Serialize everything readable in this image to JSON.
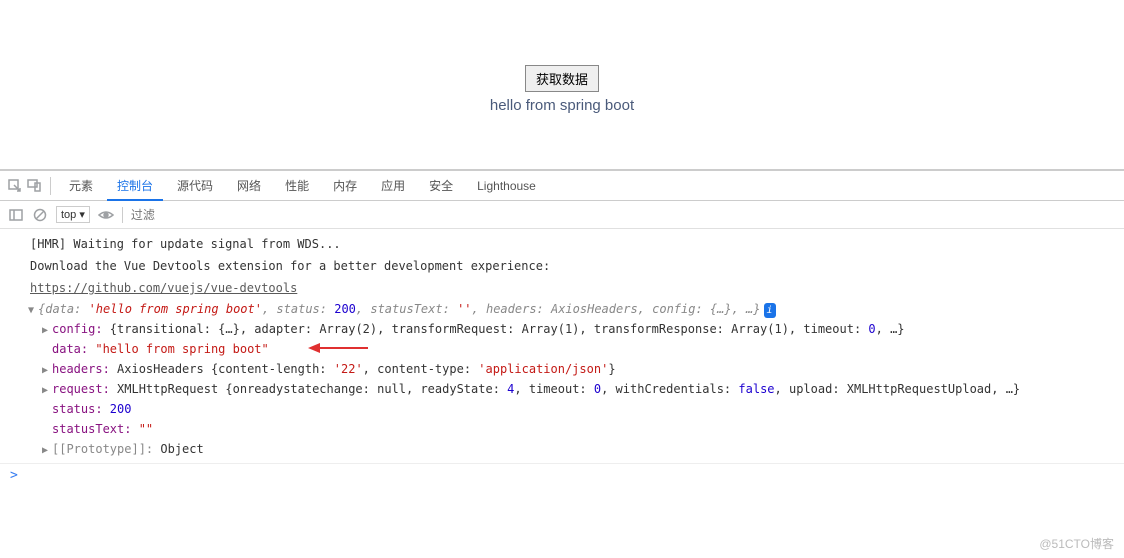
{
  "page": {
    "button_label": "获取数据",
    "response_text": "hello from spring boot"
  },
  "tabs": {
    "elements": "元素",
    "console": "控制台",
    "sources": "源代码",
    "network": "网络",
    "performance": "性能",
    "memory": "内存",
    "application": "应用",
    "security": "安全",
    "lighthouse": "Lighthouse"
  },
  "toolbar": {
    "context": "top ▾",
    "filter_placeholder": "过滤"
  },
  "console": {
    "hmr": "[HMR] Waiting for update signal from WDS...",
    "devtools_msg": "Download the Vue Devtools extension for a better development experience:",
    "devtools_link": "https://github.com/vuejs/vue-devtools",
    "summary_prefix": "{data: ",
    "summary_data": "'hello from spring boot'",
    "summary_mid1": ", status: ",
    "summary_status": "200",
    "summary_mid2": ", statusText: ",
    "summary_statustext": "''",
    "summary_mid3": ", headers: AxiosHeaders, config: {…}, …}",
    "config_key": "config:",
    "config_val": " {transitional: {…}, adapter: Array(2), transformRequest: Array(1), transformResponse: Array(1), timeout: ",
    "config_timeout": "0",
    "config_tail": ", …}",
    "data_key": "data:",
    "data_val": " \"hello from spring boot\"",
    "headers_key": "headers:",
    "headers_pre": " AxiosHeaders {content-length: ",
    "headers_len": "'22'",
    "headers_mid": ", content-type: ",
    "headers_ct": "'application/json'",
    "headers_tail": "}",
    "request_key": "request:",
    "request_pre": " XMLHttpRequest {onreadystatechange: null, readyState: ",
    "request_rs": "4",
    "request_mid1": ", timeout: ",
    "request_to": "0",
    "request_mid2": ", withCredentials: ",
    "request_wc": "false",
    "request_tail": ", upload: XMLHttpRequestUpload, …}",
    "status_key": "status:",
    "status_val": " 200",
    "statustext_key": "statusText:",
    "statustext_val": " \"\"",
    "proto_key": "[[Prototype]]:",
    "proto_val": " Object",
    "info_badge": "i"
  },
  "watermark": "@51CTO博客"
}
